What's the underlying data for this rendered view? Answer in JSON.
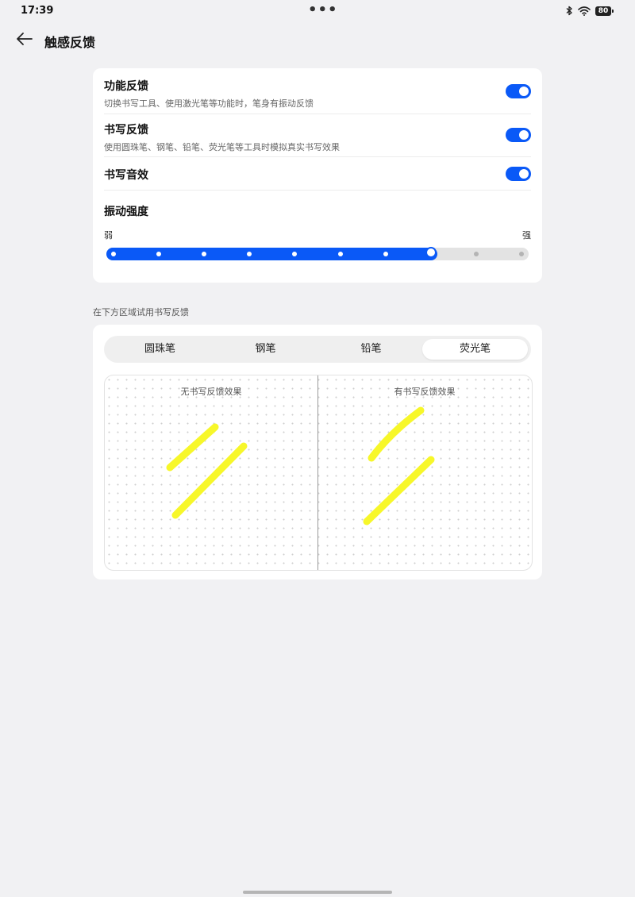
{
  "status_bar": {
    "time": "17:39",
    "dots": "•••",
    "battery": "80"
  },
  "header": {
    "title": "触感反馈"
  },
  "settings": {
    "items": [
      {
        "title": "功能反馈",
        "description": "切换书写工具、使用激光笔等功能时，笔身有振动反馈",
        "enabled": true
      },
      {
        "title": "书写反馈",
        "description": "使用圆珠笔、钢笔、铅笔、荧光笔等工具时模拟真实书写效果",
        "enabled": true
      },
      {
        "title": "书写音效",
        "description": "",
        "enabled": true
      }
    ],
    "intensity": {
      "title": "振动强度",
      "min_label": "弱",
      "max_label": "强",
      "steps": 10,
      "value": 8
    }
  },
  "trial": {
    "caption": "在下方区域试用书写反馈",
    "tools": [
      "圆珠笔",
      "钢笔",
      "铅笔",
      "荧光笔"
    ],
    "active_tool_index": 3,
    "left_panel_label": "无书写反馈效果",
    "right_panel_label": "有书写反馈效果",
    "stroke_color": "#f7f72a"
  },
  "colors": {
    "accent": "#0a59f7",
    "background": "#f1f1f3"
  }
}
